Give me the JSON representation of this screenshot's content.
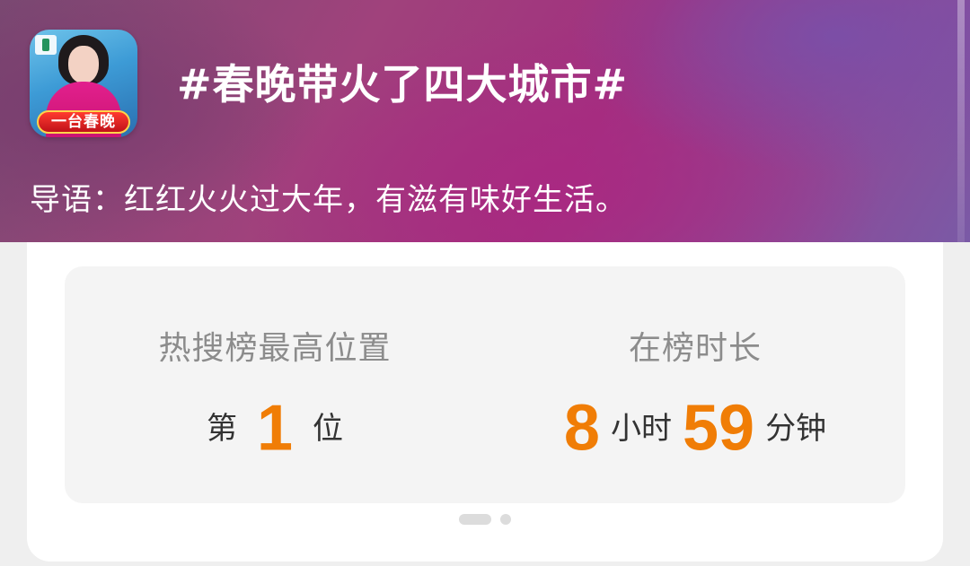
{
  "header": {
    "title": "#春晚带火了四大城市#",
    "lead": "导语：红红火火过大年，有滋有味好生活。",
    "avatar": {
      "badge_text": "一台春晚"
    }
  },
  "stats": {
    "peak": {
      "label": "热搜榜最高位置",
      "prefix": "第",
      "value": "1",
      "suffix": "位"
    },
    "duration": {
      "label": "在榜时长",
      "hours": "8",
      "hours_unit": "小时",
      "minutes": "59",
      "minutes_unit": "分钟"
    }
  },
  "pager": {
    "total": 2,
    "active": 1
  },
  "colors": {
    "accent": "#f07d06",
    "header_gradient": [
      "#7a4a72",
      "#a2307f",
      "#7a5aa6"
    ]
  }
}
